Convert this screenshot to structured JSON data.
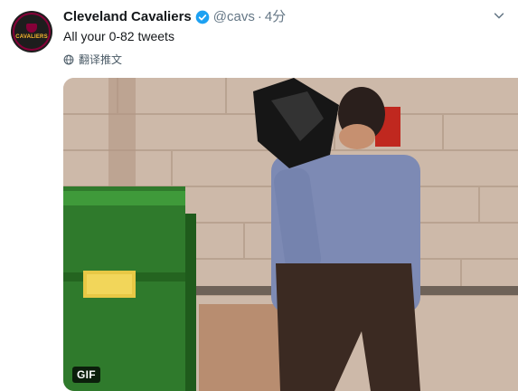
{
  "tweet": {
    "display_name": "Cleveland Cavaliers",
    "handle": "@cavs",
    "separator": "·",
    "time": "4分",
    "text": "All your 0-82 tweets",
    "translate_label": "翻译推文",
    "avatar_text": "CAVALIERS"
  },
  "media": {
    "gif_badge": "GIF"
  },
  "colors": {
    "verified": "#1da1f2",
    "team_wine": "#860038",
    "team_gold": "#fdbb30",
    "dumpster_green": "#2f7a2c"
  }
}
